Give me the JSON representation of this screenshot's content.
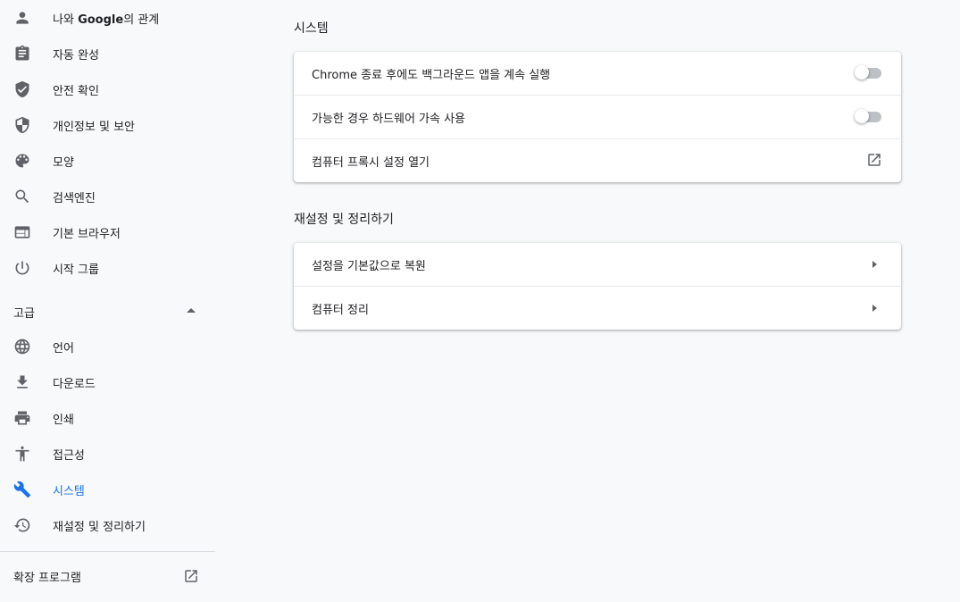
{
  "sidebar": {
    "items": [
      {
        "label_prefix": "나와 ",
        "label_bold": "Google",
        "label_suffix": "의 관계",
        "icon": "person-icon"
      },
      {
        "label": "자동 완성",
        "icon": "clipboard-icon"
      },
      {
        "label": "안전 확인",
        "icon": "shield-check-icon"
      },
      {
        "label": "개인정보 및 보안",
        "icon": "shield-half-icon"
      },
      {
        "label": "모양",
        "icon": "palette-icon"
      },
      {
        "label": "검색엔진",
        "icon": "search-icon"
      },
      {
        "label": "기본 브라우저",
        "icon": "browser-window-icon"
      },
      {
        "label": "시작 그룹",
        "icon": "power-icon"
      }
    ],
    "advanced_label": "고급",
    "advanced_items": [
      {
        "label": "언어",
        "icon": "globe-icon"
      },
      {
        "label": "다운로드",
        "icon": "download-icon"
      },
      {
        "label": "인쇄",
        "icon": "printer-icon"
      },
      {
        "label": "접근성",
        "icon": "accessibility-icon"
      },
      {
        "label": "시스템",
        "icon": "wrench-icon",
        "selected": true
      },
      {
        "label": "재설정 및 정리하기",
        "icon": "history-icon"
      }
    ],
    "extensions_label": "확장 프로그램",
    "accent_color": "#1a73e8"
  },
  "main": {
    "system_section": {
      "title": "시스템",
      "rows": [
        {
          "label": "Chrome 종료 후에도 백그라운드 앱을 계속 실행",
          "control": "toggle",
          "checked": false
        },
        {
          "label": "가능한 경우 하드웨어 가속 사용",
          "control": "toggle",
          "checked": false
        },
        {
          "label": "컴퓨터 프록시 설정 열기",
          "control": "external-link-icon"
        }
      ]
    },
    "reset_section": {
      "title": "재설정 및 정리하기",
      "rows": [
        {
          "label": "설정을 기본값으로 복원",
          "control": "arrow-right-icon"
        },
        {
          "label": "컴퓨터 정리",
          "control": "arrow-right-icon"
        }
      ]
    }
  }
}
